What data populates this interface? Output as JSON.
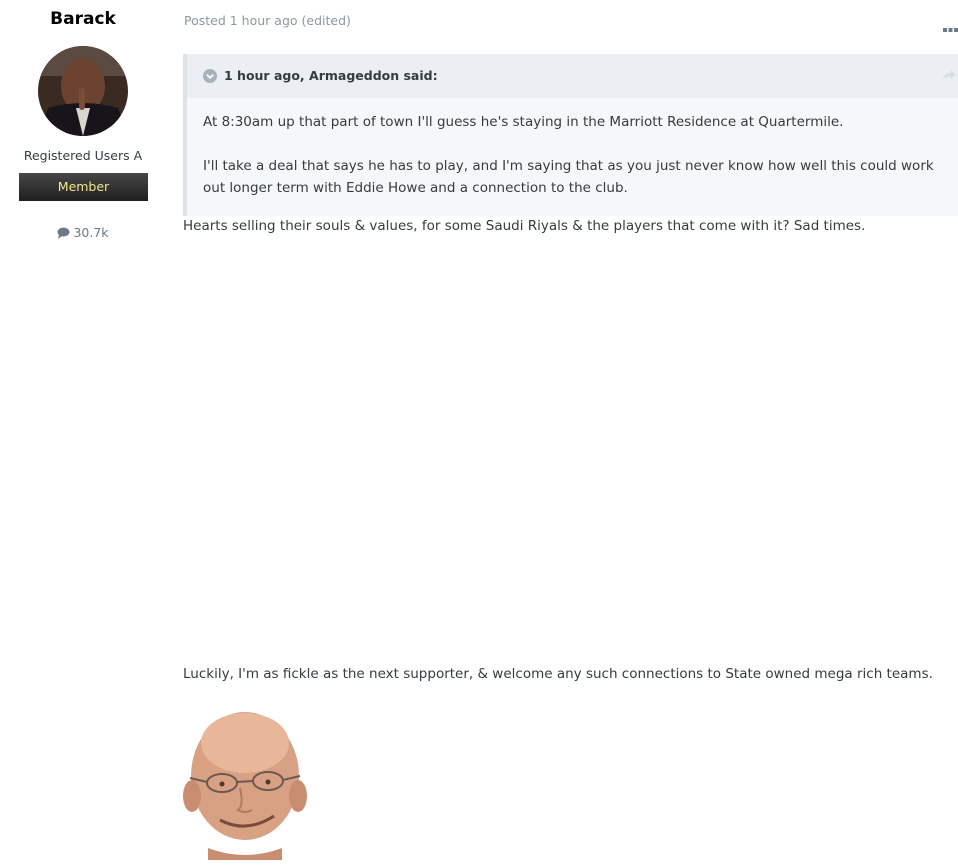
{
  "author": {
    "name": "Barack",
    "group": "Registered Users A",
    "rank": "Member",
    "post_count": "30.7k",
    "count_icon": "speech-bubble-icon"
  },
  "post": {
    "meta": "Posted 1 hour ago (edited)",
    "quote": {
      "citation": "1 hour ago, Armageddon said:",
      "paragraphs": [
        "At 8:30am up that part of town I'll guess he's staying in the Marriott Residence at Quartermile.",
        "I'll take a deal that says he has to play, and I'm saying that as you just never know how well this could work out longer term with Eddie Howe and a connection to the club."
      ]
    },
    "paragraphs": [
      "Hearts selling their souls & values, for some Saudi Riyals & the players that come with it? Sad times.",
      "Luckily, I'm as fickle as the next supporter, & welcome any such connections to State owned mega rich teams."
    ]
  },
  "colors": {
    "rank_text": "#f5e48a",
    "meta_text": "#8a99a8",
    "quote_bg": "#f5f7fa"
  }
}
